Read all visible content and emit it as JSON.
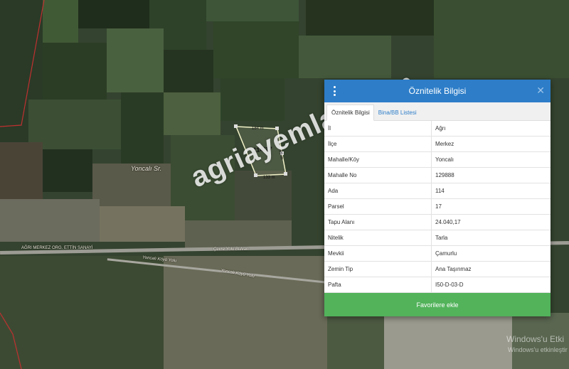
{
  "map": {
    "village_label": "Yoncalı Sr.",
    "road_label_1": "AĞRI MERKEZ ORG. ETTİN SANAYİ",
    "road_label_2": "Çevre Yolu Bulvarı",
    "road_label_3": "Yoncalı Köyü Yolu",
    "road_label_4": "Yoncalı Köyü Yolu",
    "parcel": {
      "id_label": "114/17",
      "edge_top": "184 m",
      "edge_bottom": "133 m",
      "edge_right": "196 m"
    },
    "watermark": "agriayemlak.com",
    "windows_line1": "Windows'u Etki",
    "windows_line2": "Windows'u etkinleştir"
  },
  "panel": {
    "title": "Öznitelik Bilgisi",
    "tabs": [
      {
        "label": "Öznitelik Bilgisi",
        "active": true
      },
      {
        "label": "Bina/BB Listesi",
        "active": false
      }
    ],
    "rows": [
      {
        "key": "İl",
        "value": "Ağrı"
      },
      {
        "key": "İlçe",
        "value": "Merkez"
      },
      {
        "key": "Mahalle/Köy",
        "value": "Yoncalı"
      },
      {
        "key": "Mahalle No",
        "value": "129888"
      },
      {
        "key": "Ada",
        "value": "114"
      },
      {
        "key": "Parsel",
        "value": "17"
      },
      {
        "key": "Tapu Alanı",
        "value": "24.040,17"
      },
      {
        "key": "Nitelik",
        "value": "Tarla"
      },
      {
        "key": "Mevkii",
        "value": "Çamurlu"
      },
      {
        "key": "Zemin Tip",
        "value": "Ana Taşınmaz"
      },
      {
        "key": "Pafta",
        "value": "I50-D-03-D"
      }
    ],
    "favorite_button": "Favorilere ekle"
  },
  "colors": {
    "header": "#2d7dc8",
    "button": "#52b35b",
    "parcel_stroke": "#f2f2c8"
  }
}
